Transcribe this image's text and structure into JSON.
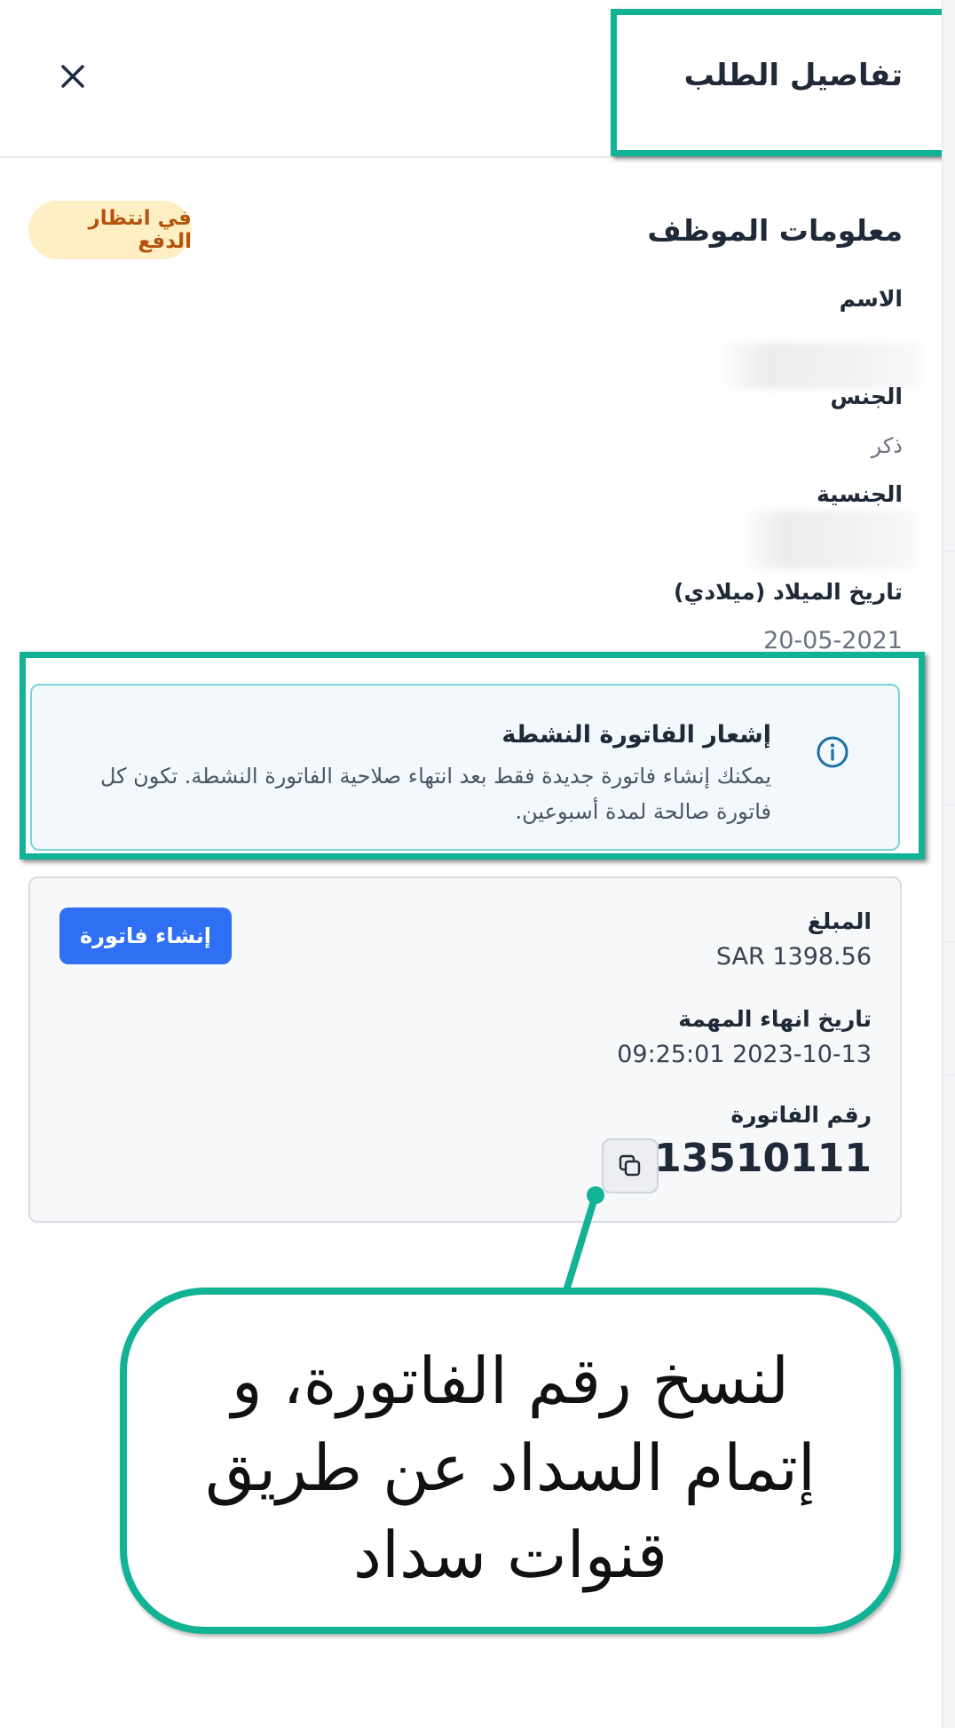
{
  "header": {
    "title": "تفاصيل الطلب"
  },
  "status_badge": "في انتظار الدفع",
  "employee": {
    "section_title": "معلومات الموظف",
    "name_label": "الاسم",
    "gender_label": "الجنس",
    "gender_value": "ذكر",
    "nationality_label": "الجنسية",
    "birthdate_label": "تاريخ الميلاد (ميلادي)",
    "birthdate_value": "20-05-2021"
  },
  "notice": {
    "title": "إشعار الفاتورة النشطة",
    "text": "يمكنك إنشاء فاتورة جديدة فقط بعد انتهاء صلاحية الفاتورة النشطة. تكون كل فاتورة صالحة لمدة أسبوعين."
  },
  "invoice": {
    "amount_label": "المبلغ",
    "amount_value": "SAR 1398.56",
    "end_date_label": "تاريخ انهاء المهمة",
    "end_date_value": "09:25:01 2023-10-13",
    "number_label": "رقم الفاتورة",
    "number_value": "13510111",
    "create_button": "إنشاء فاتورة"
  },
  "callout": {
    "line1": "لنسخ رقم  الفاتورة، و",
    "line2": "إتمام السداد عن طريق",
    "line3": "قنوات سداد"
  },
  "colors": {
    "highlight": "#12b295",
    "primary_button": "#2f6ff4",
    "badge_bg": "#fdefc3",
    "badge_text": "#b4540e",
    "notice_bg": "#f2f8fb",
    "notice_border": "#79d2df",
    "info_icon": "#1d6fa5"
  },
  "icons": {
    "close": "close-icon",
    "info": "info-icon",
    "copy": "copy-icon"
  }
}
